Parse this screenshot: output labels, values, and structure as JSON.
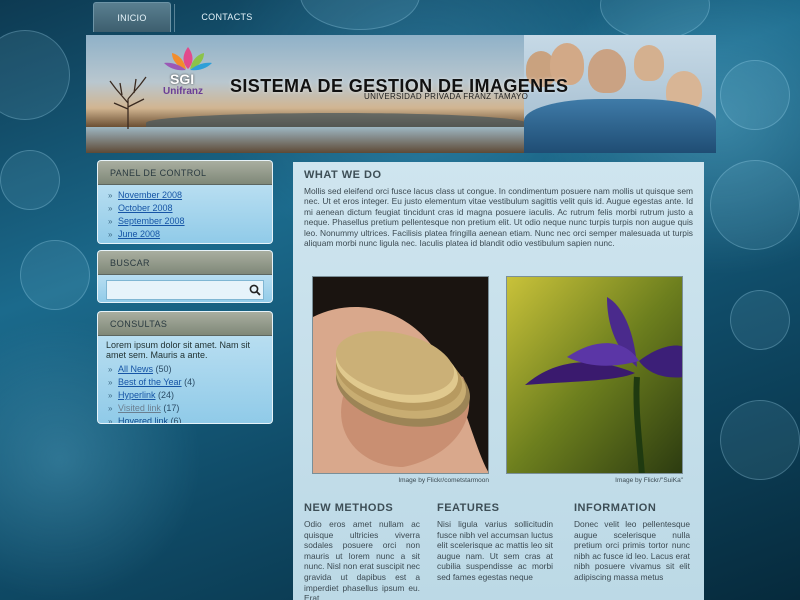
{
  "nav": {
    "items": [
      {
        "label": "INICIO",
        "active": true
      },
      {
        "label": "CONTACTS",
        "active": false
      }
    ]
  },
  "header": {
    "logo_sgi": "SGI",
    "logo_org": "Unifranz",
    "title": "SISTEMA DE GESTION DE IMAGENES",
    "subtitle": "UNIVERSIDAD PRIVADA FRANZ TAMAYO"
  },
  "sidebar": {
    "panel": {
      "title": "PANEL DE CONTROL",
      "items": [
        "November 2008",
        "October 2008",
        "September 2008",
        "June 2008"
      ]
    },
    "search": {
      "title": "BUSCAR",
      "value": ""
    },
    "consultas": {
      "title": "CONSULTAS",
      "text": "Lorem ipsum dolor sit amet. Nam sit amet sem. Mauris a ante.",
      "items": [
        {
          "label": "All News",
          "count": "(50)",
          "state": "normal"
        },
        {
          "label": "Best of the Year",
          "count": "(4)",
          "state": "normal"
        },
        {
          "label": "Hyperlink",
          "count": "(24)",
          "state": "normal"
        },
        {
          "label": "Visited link",
          "count": "(17)",
          "state": "visited"
        },
        {
          "label": "Hovered link",
          "count": "(6)",
          "state": "hovered"
        }
      ]
    }
  },
  "main": {
    "heading": "WHAT WE DO",
    "paragraph": "Mollis sed eleifend orci fusce lacus class ut congue. In condimentum posuere nam mollis ut quisque sem nec. Ut et eros integer. Eu justo elementum vitae vestibulum sagittis velit quis id. Augue egestas ante. Id mi aenean dictum feugiat tincidunt cras id magna posuere iaculis. Ac rutrum felis morbi rutrum justo a neque. Phasellus pretium pellentesque non pretium elit. Ut odio neque nunc turpis turpis non augue quis leo. Nonummy ultrices. Facilisis platea fringilla aenean etiam. Nunc nec orci semper malesuada ut turpis aliquam morbi nunc ligula nec. Iaculis platea id blandit odio vestibulum sapien nunc.",
    "photos": [
      {
        "caption": "Image by Flickr/cometstarmoon"
      },
      {
        "caption": "Image by Flickr/\"SuiKa\""
      }
    ],
    "columns": [
      {
        "heading": "NEW METHODS",
        "text": "Odio eros amet nullam ac quisque ultricies viverra sodales posuere orci non mauris ut lorem nunc a sit nunc. Nisl non erat suscipit nec gravida ut dapibus est a imperdiet phasellus ipsum eu. Erat"
      },
      {
        "heading": "FEATURES",
        "text": "Nisi ligula varius sollicitudin fusce nibh vel accumsan luctus elit scelerisque ac mattis leo sit augue nam. Ut sem cras at cubilia suspendisse ac morbi sed fames egestas neque"
      },
      {
        "heading": "INFORMATION",
        "text": "Donec velit leo pellentesque augue scelerisque nulla pretium orci primis tortor nunc nibh ac fusce id leo. Lacus erat nibh posuere vivamus sit elit adipiscing massa metus"
      }
    ]
  },
  "colors": {
    "background": "#0f4a66",
    "link": "#1655a6",
    "content_bg": "#cfe5ef"
  }
}
